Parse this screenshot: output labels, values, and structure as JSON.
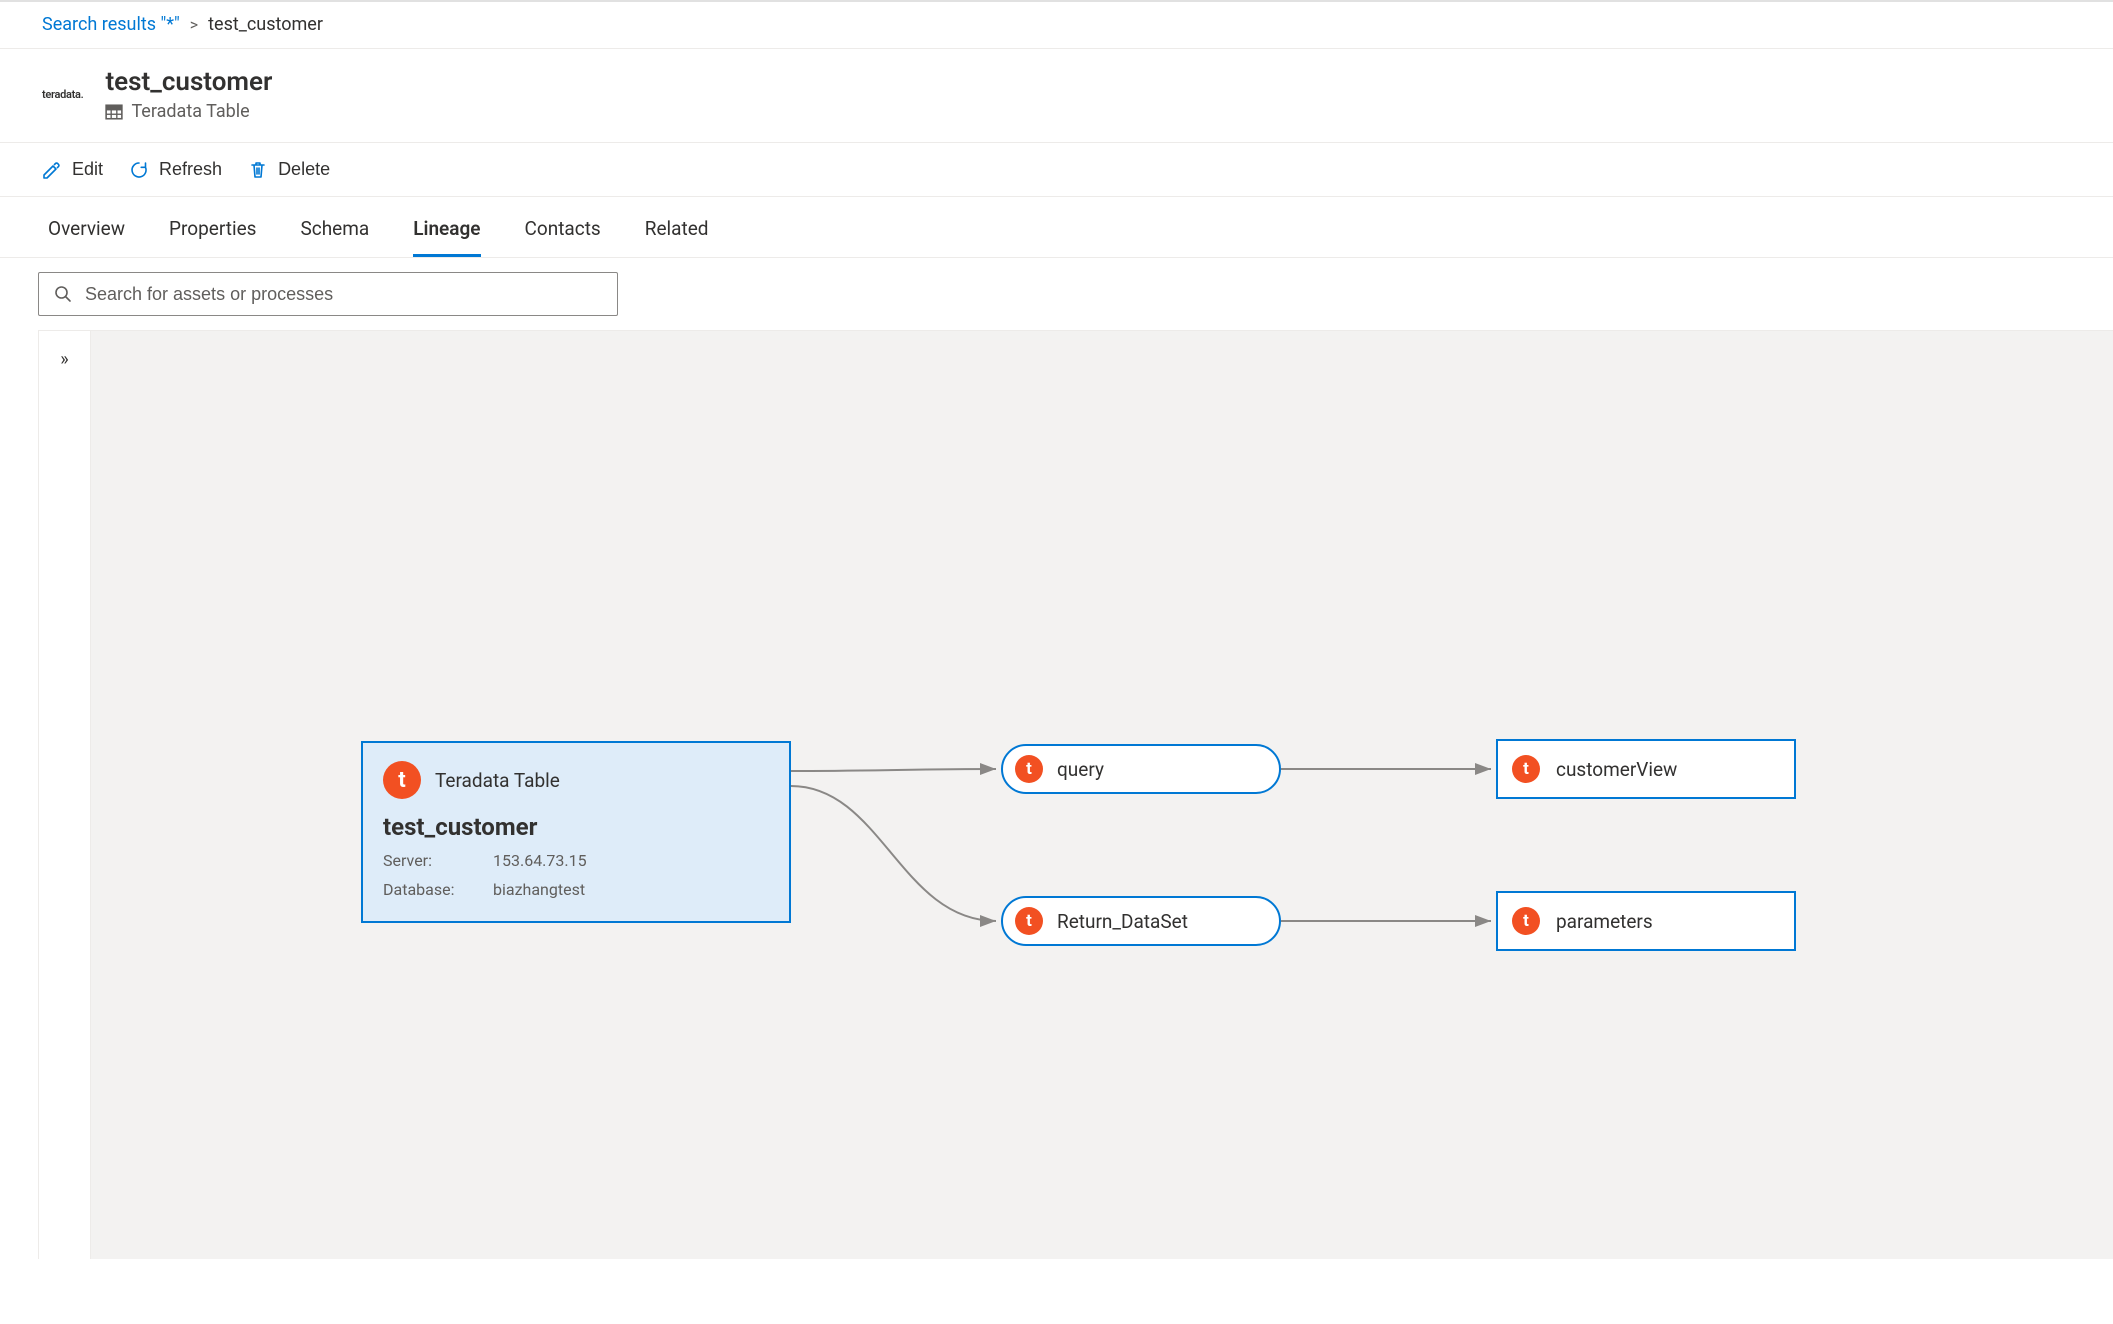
{
  "breadcrumb": {
    "link_label": "Search results \"*\"",
    "separator": ">",
    "current": "test_customer"
  },
  "header": {
    "brand": "teradata.",
    "title": "test_customer",
    "subtitle": "Teradata Table"
  },
  "toolbar": {
    "edit_label": "Edit",
    "refresh_label": "Refresh",
    "delete_label": "Delete"
  },
  "tabs": {
    "items": [
      {
        "label": "Overview",
        "active": false
      },
      {
        "label": "Properties",
        "active": false
      },
      {
        "label": "Schema",
        "active": false
      },
      {
        "label": "Lineage",
        "active": true
      },
      {
        "label": "Contacts",
        "active": false
      },
      {
        "label": "Related",
        "active": false
      }
    ]
  },
  "search": {
    "placeholder": "Search for assets or processes"
  },
  "side_panel": {
    "expand_glyph": "»"
  },
  "lineage": {
    "source": {
      "type_label": "Teradata Table",
      "name": "test_customer",
      "server_label": "Server:",
      "server_value": "153.64.73.15",
      "database_label": "Database:",
      "database_value": "biazhangtest",
      "icon_letter": "t"
    },
    "proc1": {
      "label": "query",
      "icon_letter": "t"
    },
    "proc2": {
      "label": "Return_DataSet",
      "icon_letter": "t"
    },
    "out1": {
      "label": "customerView",
      "icon_letter": "t"
    },
    "out2": {
      "label": "parameters",
      "icon_letter": "t"
    }
  }
}
